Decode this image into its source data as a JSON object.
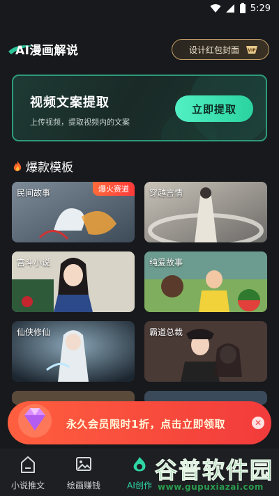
{
  "status_bar": {
    "time": "5:29"
  },
  "header": {
    "title": "AI漫画解说",
    "cover_button_label": "设计红包封面",
    "vip_badge": "VIP"
  },
  "banner": {
    "title": "视频文案提取",
    "subtitle": "上传视频，提取视频内的文案",
    "button_label": "立即提取"
  },
  "section": {
    "title": "爆款模板",
    "icon": "fire-icon"
  },
  "templates": [
    {
      "label": "民间故事",
      "tag": "爆火赛道"
    },
    {
      "label": "穿越言情"
    },
    {
      "label": "宫斗小说"
    },
    {
      "label": "纯爱故事"
    },
    {
      "label": "仙侠修仙"
    },
    {
      "label": "霸道总裁"
    }
  ],
  "promo": {
    "text": "永久会员限时1折，点击立即领取",
    "close_icon": "close-icon"
  },
  "bottom_nav": [
    {
      "label": "小说推文",
      "icon": "book-icon",
      "active": false
    },
    {
      "label": "绘画赚钱",
      "icon": "image-icon",
      "active": false
    },
    {
      "label": "AI创作",
      "icon": "ai-create-icon",
      "active": true
    }
  ],
  "watermark": {
    "main": "谷普软件园",
    "url": "www.gupuxiazai.com"
  },
  "colors": {
    "accent": "#2fd6a6",
    "promo": "#f24a3c",
    "gold": "#c7a26a"
  }
}
